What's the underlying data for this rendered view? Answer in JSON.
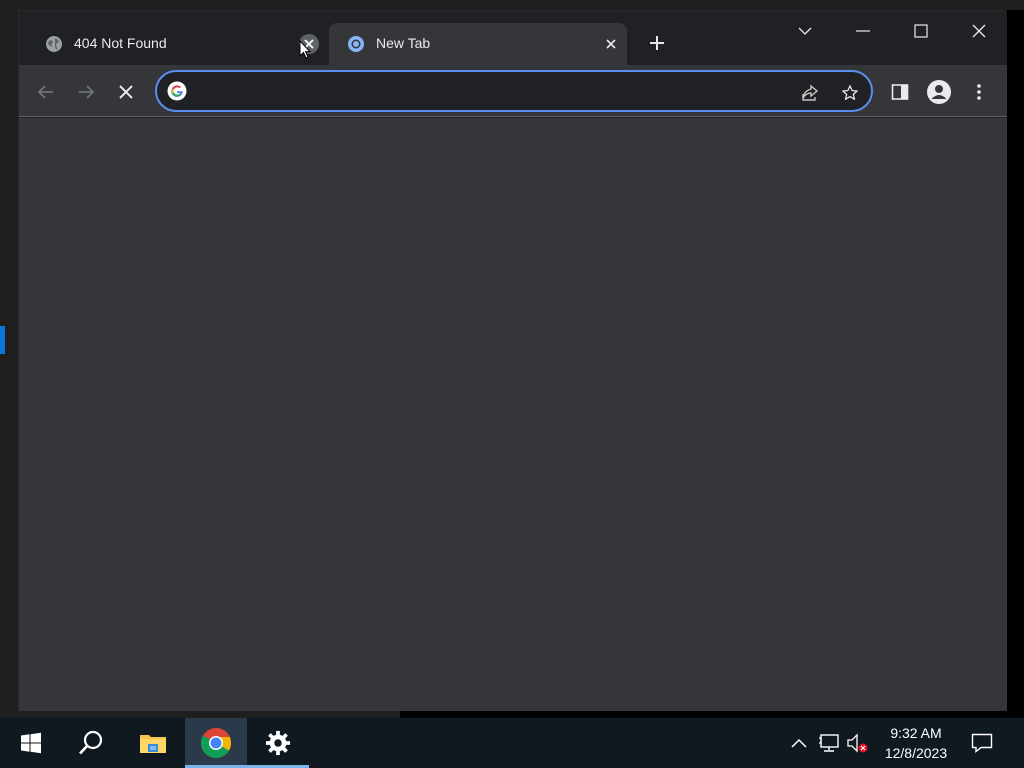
{
  "browser": {
    "tabs": [
      {
        "title": "404 Not Found",
        "favicon": "globe-icon",
        "active": false
      },
      {
        "title": "New Tab",
        "favicon": "chrome-icon",
        "active": true
      }
    ],
    "new_tab_icon": "plus-icon",
    "window_controls": [
      "tab-search-icon",
      "minimize-icon",
      "maximize-icon",
      "close-icon"
    ],
    "toolbar": {
      "back_icon": "back-arrow-icon",
      "forward_icon": "forward-arrow-icon",
      "stop_icon": "stop-loading-icon",
      "address_value": "",
      "address_placeholder": "",
      "share_icon": "share-icon",
      "bookmark_icon": "star-icon",
      "side_panel_icon": "side-panel-icon",
      "profile_icon": "profile-icon",
      "menu_icon": "kebab-menu-icon"
    },
    "colors": {
      "frame": "#202124",
      "toolbar": "#35363a",
      "omnibox_focus": "#5b8def"
    }
  },
  "taskbar": {
    "apps": [
      "windows-start-icon",
      "search-icon",
      "file-explorer-icon",
      "chrome-icon",
      "settings-icon"
    ],
    "active_app": "chrome-icon",
    "tray": [
      "chevron-up-icon",
      "network-icon",
      "volume-muted-icon"
    ],
    "time": "9:32 AM",
    "date": "12/8/2023",
    "notification_icon": "notification-icon"
  }
}
